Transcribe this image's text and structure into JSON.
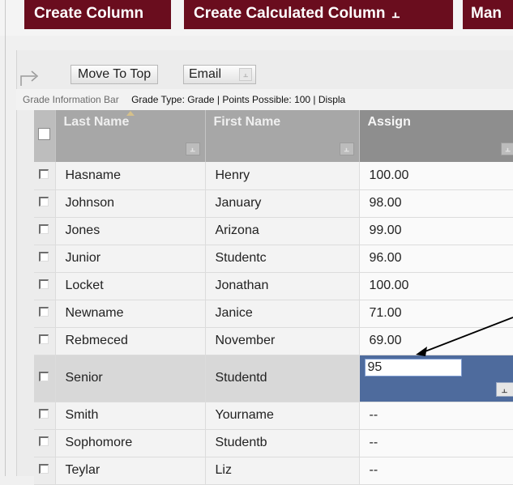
{
  "toolbar": {
    "create_column": "Create Column",
    "create_calculated": "Create Calculated Column",
    "manage": "Man"
  },
  "actions": {
    "move_to_top": "Move To Top",
    "email": "Email"
  },
  "info_bar": {
    "label": "Grade Information Bar",
    "value": "Grade Type: Grade | Points Possible: 100 | Displa"
  },
  "columns": {
    "last_name": "Last Name",
    "first_name": "First Name",
    "assign": "Assign"
  },
  "rows": [
    {
      "last": "Hasname",
      "first": "Henry",
      "grade": "100.00"
    },
    {
      "last": "Johnson",
      "first": "January",
      "grade": "98.00"
    },
    {
      "last": "Jones",
      "first": "Arizona",
      "grade": "99.00"
    },
    {
      "last": "Junior",
      "first": "Studentc",
      "grade": "96.00"
    },
    {
      "last": "Locket",
      "first": "Jonathan",
      "grade": "100.00"
    },
    {
      "last": "Newname",
      "first": "Janice",
      "grade": "71.00"
    },
    {
      "last": "Rebmeced",
      "first": "November",
      "grade": "69.00"
    },
    {
      "last": "Senior",
      "first": "Studentd",
      "grade_input": "95"
    },
    {
      "last": "Smith",
      "first": "Yourname",
      "grade": "--"
    },
    {
      "last": "Sophomore",
      "first": "Studentb",
      "grade": "--"
    },
    {
      "last": "Teylar",
      "first": "Liz",
      "grade": "--"
    }
  ],
  "colors": {
    "brand": "#6a0d1e",
    "header_gray": "#a7a7a7",
    "edit_cell": "#4e6b9d"
  },
  "icons": {
    "chevron": "chevron-double-down-icon",
    "arrow": "curved-arrow-icon"
  }
}
